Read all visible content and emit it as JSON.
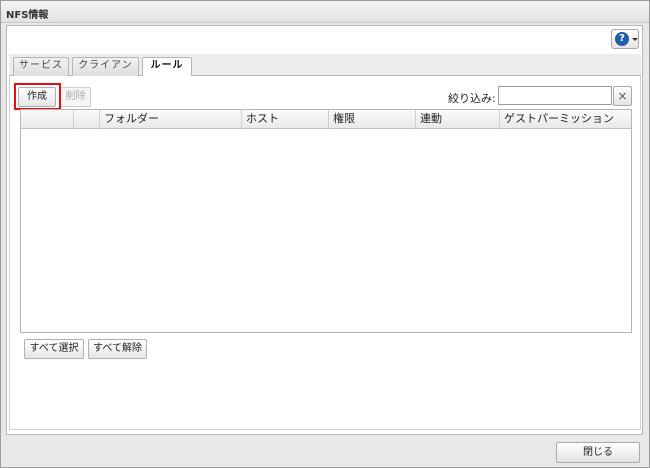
{
  "window": {
    "title": "NFS情報"
  },
  "help": {
    "icon": "help-icon",
    "label": "?"
  },
  "tabs": [
    {
      "label": "サービス",
      "active": false
    },
    {
      "label": "クライアント",
      "active": false
    },
    {
      "label": "ルール",
      "active": true
    }
  ],
  "toolbar": {
    "create_label": "作成",
    "delete_label": "削除",
    "filter_label": "絞り込み:",
    "filter_value": "",
    "clear_icon": "close-icon",
    "clear_label": "×"
  },
  "table": {
    "columns": [
      "",
      "",
      "フォルダー",
      "ホスト",
      "権限",
      "連動",
      "ゲストパーミッション"
    ],
    "rows": []
  },
  "selection": {
    "select_all_label": "すべて選択",
    "deselect_all_label": "すべて解除"
  },
  "footer": {
    "close_label": "閉じる"
  },
  "colors": {
    "highlight": "#e01010",
    "help_icon": "#1f5fa8"
  }
}
